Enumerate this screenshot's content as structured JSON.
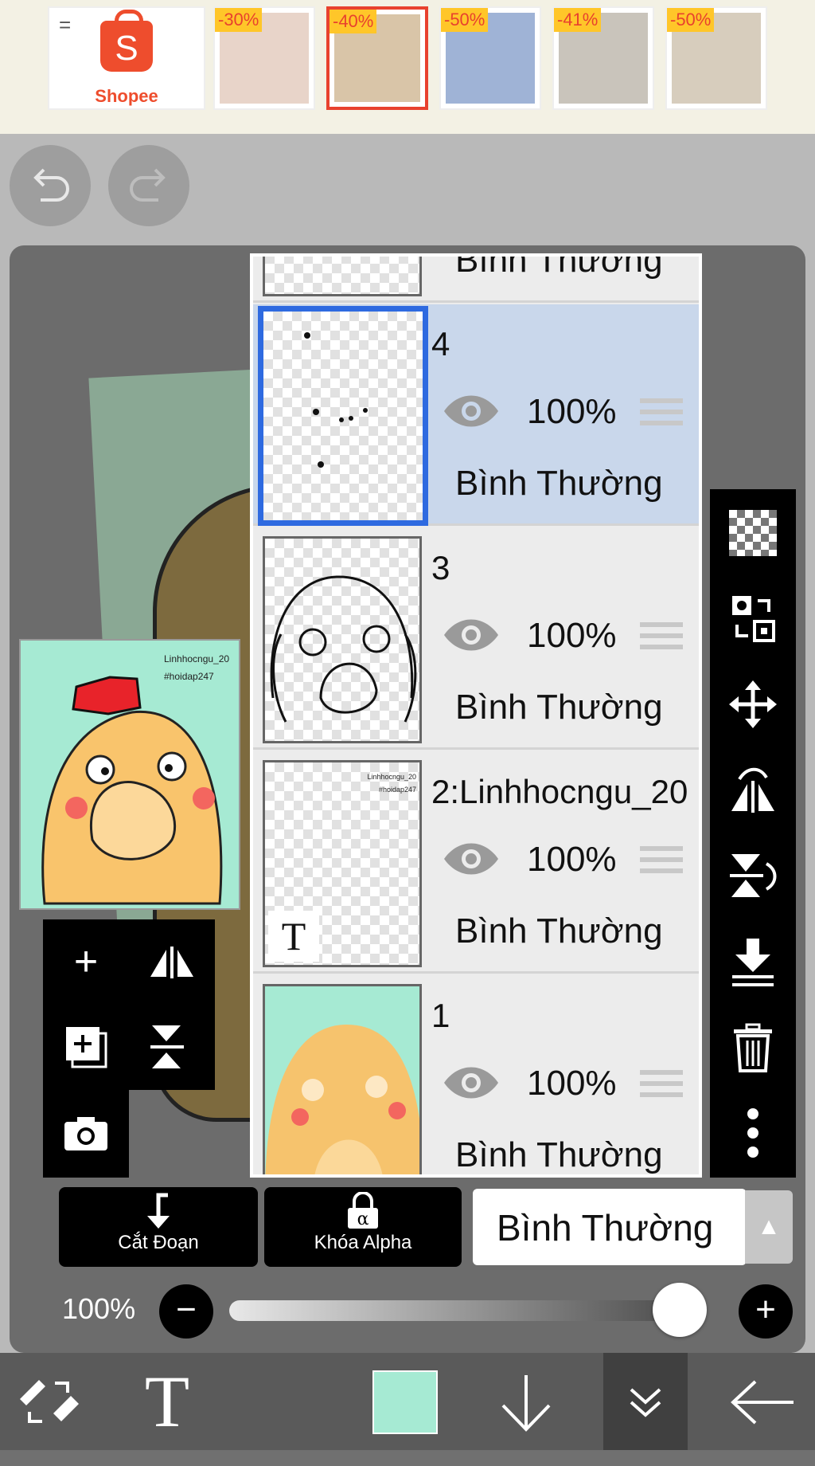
{
  "ads": {
    "brand": "Shopee",
    "menu_glyph": "=",
    "items": [
      {
        "discount": "-30%",
        "color": "#e8d4c9"
      },
      {
        "discount": "-40%",
        "color": "#d9c5a8"
      },
      {
        "discount": "-50%",
        "color": "#9fb3d6"
      },
      {
        "discount": "-41%",
        "color": "#c9c4bb"
      },
      {
        "discount": "-50%",
        "color": "#d7cdbd"
      }
    ]
  },
  "history": {
    "undo_icon": "undo-icon",
    "redo_icon": "redo-icon"
  },
  "preview": {
    "credit_line1": "Linhhocngu_20",
    "credit_line2": "#hoidap247"
  },
  "layers": [
    {
      "name": "",
      "opacity": "",
      "blend": "Bình Thường",
      "partial": true
    },
    {
      "name": "4",
      "opacity": "100%",
      "blend": "Bình Thường",
      "selected": true
    },
    {
      "name": "3",
      "opacity": "100%",
      "blend": "Bình Thường"
    },
    {
      "name": "2:Linhhocngu_20",
      "opacity": "100%",
      "blend": "Bình Thường",
      "thumb_text_1": "Linhhocngu_20",
      "thumb_text_2": "#hoidap247",
      "thumb_type_glyph": "T"
    },
    {
      "name": "1",
      "opacity": "100%",
      "blend": "Bình Thường"
    }
  ],
  "left_tools": [
    "add-layer-icon",
    "flip-horizontal-icon",
    "duplicate-layer-icon",
    "flip-vertical-icon",
    "camera-icon"
  ],
  "right_tools": [
    "transparent-icon",
    "swap-layer-icon",
    "move-icon",
    "flip-horizontal-icon",
    "flip-vertical-icon",
    "merge-down-icon",
    "trash-icon",
    "more-icon"
  ],
  "controls": {
    "clip_label": "Cắt Đoạn",
    "alpha_lock_label": "Khóa Alpha",
    "alpha_glyph": "α",
    "blend_mode": "Bình Thường",
    "opacity_text": "100%",
    "opacity_value": 1.0
  },
  "bottom_nav": {
    "text_tool_glyph": "T",
    "current_color": "#a6ead3"
  },
  "colors": {
    "selected_border": "#2e6ae0",
    "selected_bg": "#c9d7eb",
    "shopee": "#ee4d2d"
  }
}
